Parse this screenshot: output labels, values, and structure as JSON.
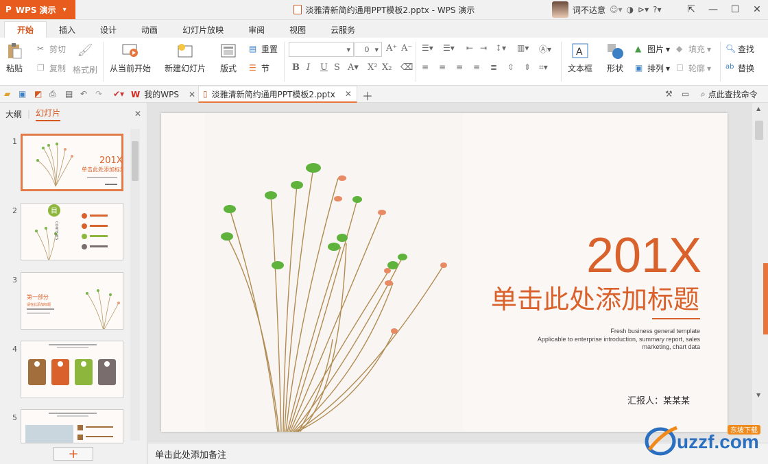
{
  "app": {
    "logo": "P",
    "name": "WPS 演示"
  },
  "window": {
    "title": "淡雅清新简约通用PPT模板2.pptx - WPS 演示"
  },
  "user": {
    "name": "词不达意"
  },
  "tabs": [
    "开始",
    "插入",
    "设计",
    "动画",
    "幻灯片放映",
    "审阅",
    "视图",
    "云服务"
  ],
  "ribbon": {
    "paste": "粘贴",
    "cut": "剪切",
    "copy": "复制",
    "format_painter": "格式刷",
    "from_current": "从当前开始",
    "new_slide": "新建幻灯片",
    "layout": "版式",
    "reset": "重置",
    "section": "节",
    "font_size": "0",
    "textbox": "文本框",
    "shape": "形状",
    "picture": "图片",
    "fill": "填充",
    "arrange": "排列",
    "outline": "轮廓",
    "find": "查找",
    "replace": "替换"
  },
  "doctabs": {
    "home": "我的WPS",
    "file": "淡雅清新简约通用PPT模板2.pptx",
    "search": "点此查找命令"
  },
  "leftpanel": {
    "outline_tab": "大纲",
    "slides_tab": "幻灯片",
    "slide_numbers": [
      "1",
      "2",
      "3",
      "4",
      "5"
    ],
    "add": "+"
  },
  "thumbs": {
    "t1_year": "201X",
    "t1_title": "单击此处添加标题",
    "t2_char": "目",
    "t2_vertical": "CONTENTS",
    "t3_part": "第一部分",
    "t3_sub": "请在此添加标题"
  },
  "slide": {
    "year": "201X",
    "title": "单击此处添加标题",
    "sub1": "Fresh business general template",
    "sub2": "Applicable to enterprise introduction, summary report, sales",
    "sub3": "marketing, chart data",
    "reporter": "汇报人：某某某"
  },
  "notes": {
    "placeholder": "单击此处添加备注"
  },
  "watermark": {
    "text": "uzzf.com",
    "tag": "东坡下载"
  },
  "colors": {
    "accent": "#e85d1e",
    "title_orange": "#d9612b"
  }
}
